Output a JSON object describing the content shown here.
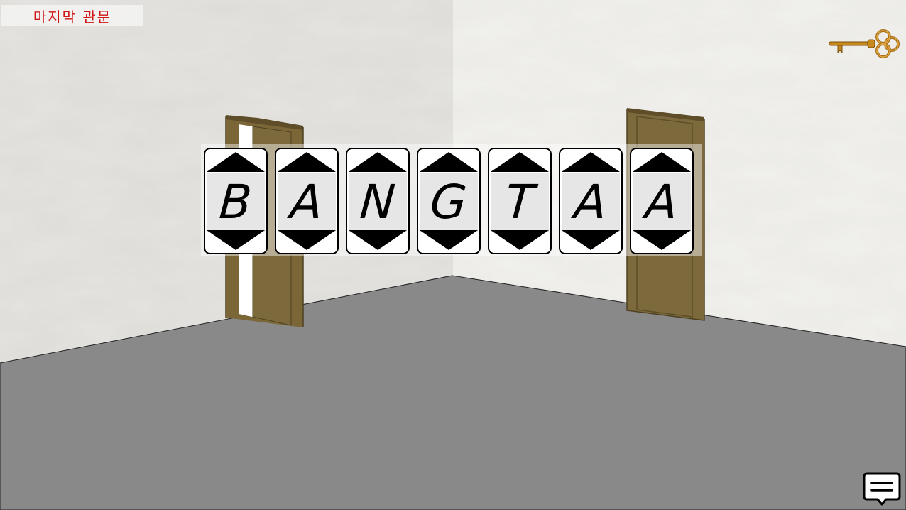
{
  "title": "마지막 관문",
  "icons": {
    "inventory_key": "key-icon",
    "message": "chat-bubble-icon",
    "wheel_up": "triangle-up-icon",
    "wheel_down": "triangle-down-icon"
  },
  "colors": {
    "title_text": "#d01414",
    "floor": "#898989",
    "door": "#7d6a3c",
    "key_gold": "#c88a1c"
  },
  "lock": {
    "letters": [
      "B",
      "A",
      "N",
      "G",
      "T",
      "A",
      "A"
    ]
  }
}
